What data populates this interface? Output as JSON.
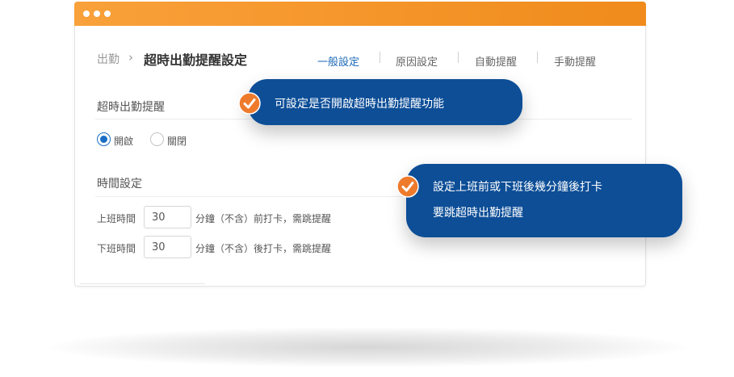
{
  "breadcrumb": {
    "parent": "出勤",
    "separator": "›",
    "current": "超時出勤提醒設定"
  },
  "tabs": [
    {
      "label": "一般設定",
      "active": true
    },
    {
      "label": "原因設定",
      "active": false
    },
    {
      "label": "自動提醒",
      "active": false
    },
    {
      "label": "手動提醒",
      "active": false
    }
  ],
  "overtime_reminder": {
    "title": "超時出勤提醒",
    "options": [
      {
        "label": "開啟",
        "selected": true
      },
      {
        "label": "關閉",
        "selected": false
      }
    ]
  },
  "time_settings": {
    "title": "時間設定",
    "rows": [
      {
        "label": "上班時間",
        "value": "30",
        "suffix": "分鐘（不含）前打卡，需跳提醒"
      },
      {
        "label": "下班時間",
        "value": "30",
        "suffix": "分鐘（不含）後打卡，需跳提醒"
      }
    ]
  },
  "callouts": [
    {
      "lines": [
        "可設定是否開啟超時出勤提醒功能"
      ]
    },
    {
      "lines": [
        "設定上班前或下班後幾分鐘後打卡",
        "要跳超時出勤提醒"
      ]
    }
  ],
  "colors": {
    "titlebar": "#f39224",
    "accent": "#1a6ec4",
    "callout": "#0d4e97",
    "badge": "#ee7a2c"
  }
}
